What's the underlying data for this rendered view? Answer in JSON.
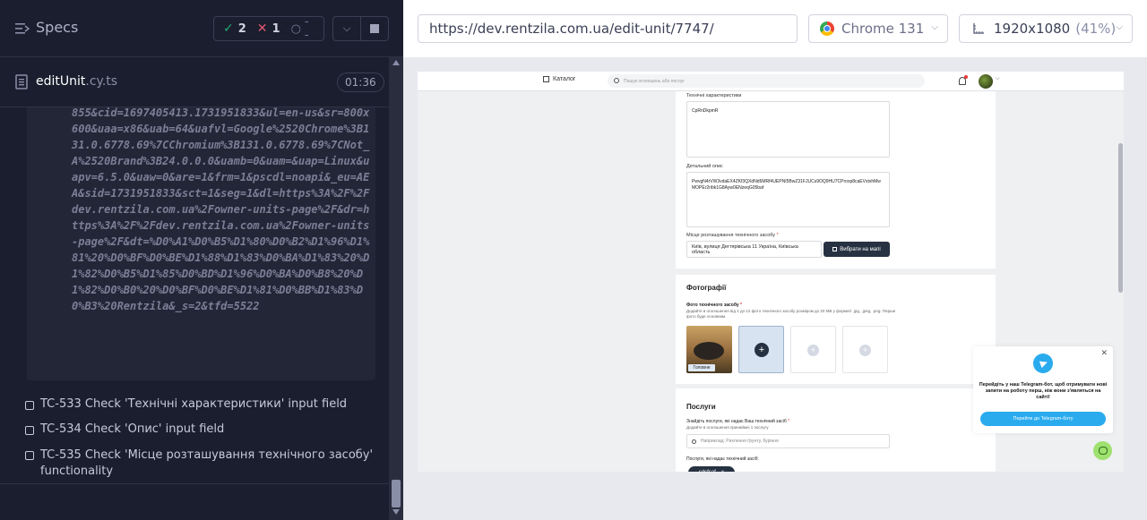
{
  "sidebar": {
    "title": "Specs",
    "stats": {
      "passed": "2",
      "failed": "1",
      "pending": "--"
    },
    "spec_file": {
      "name": "editUnit",
      "ext": ".cy.ts",
      "duration": "01:36"
    },
    "code_snippet": "855&cid=1697405413.1731951833&ul=en-us&sr=800x600&uaa=x86&uab=64&uafvl=Google%2520Chrome%3B131.0.6778.69%7CChromium%3B131.0.6778.69%7CNot_A%2520Brand%3B24.0.0.0&uamb=0&uam=&uap=Linux&uapv=6.5.0&uaw=0&are=1&frm=1&pscdl=noapi&_eu=AEA&sid=1731951833&sct=1&seg=1&dl=https%3A%2F%2Fdev.rentzila.com.ua%2Fowner-units-page%2F&dr=https%3A%2F%2Fdev.rentzila.com.ua%2Fowner-units-page%2F&dt=%D0%A1%D0%B5%D1%80%D0%B2%D1%96%D1%81%20%D0%BF%D0%BE%D1%88%D1%83%D0%BA%D1%83%20%D1%82%D0%B5%D1%85%D0%BD%D1%96%D0%BA%D0%B8%20%D1%82%D0%B0%20%D0%BF%D0%BE%D1%81%D0%BB%D1%83%D0%B3%20Rentzila&_s=2&tfd=5522",
    "tests": [
      {
        "label": "TC-533 Check 'Технічні характеристики' input field"
      },
      {
        "label": "TC-534 Check 'Опис' input field"
      },
      {
        "label": "TC-535 Check 'Місце розташування технічного засобу' functionality"
      }
    ]
  },
  "toolbar": {
    "url": "https://dev.rentzila.com.ua/edit-unit/7747/",
    "browser": "Chrome 131",
    "viewport": "1920x1080",
    "zoom": "(41%)"
  },
  "aut": {
    "catalog_label": "Каталог",
    "search_placeholder": "Пошук оголошень або послуг",
    "tech_label": "Технічні характеристики",
    "tech_value": "CpRnDkpmR",
    "desc_label": "Детальний опис",
    "desc_value": "PwvgN4rVW3vdaEX4ZKf3QXdNd6MRf4UEPNI5BwZ31FJUCs9OQ9HU7CProxp8caEVstxhMwMOPEr2ribk1G8Ayw0ENzeqG05baf",
    "location_label": "Місце розташування технічного засобу",
    "location_value": "Київ, вулиця Дегтярівська 11 Україна, Київська область",
    "map_button": "Вибрати на мапі",
    "photos_title": "Фотографії",
    "photos_label": "Фото технічного засобу",
    "photos_desc": "Додайте в оголошення від 1 до 12 фото технічного засобу розміром до 20 МБ у форматі .jpg, .jpeg, .png. Перше фото буде основним.",
    "photo_main": "Головне",
    "services_title": "Послуги",
    "services_find": "Знайдіть послуги, які надає Ваш технічний засіб",
    "services_desc": "Додайте в оголошення принаймні 1 послугу",
    "services_placeholder": "Наприклад: Рихлення ґрунту, буріння",
    "services_provided": "Послуги, які надає технічний засіб:",
    "service_tag": "sdsfsaf",
    "telegram_text": "Перейдіть у наш Telegram-бот, щоб отримувати нові запити на роботу перш, ніж вони з'являться на сайті!",
    "telegram_button": "Перейти до Telegram-боту"
  }
}
